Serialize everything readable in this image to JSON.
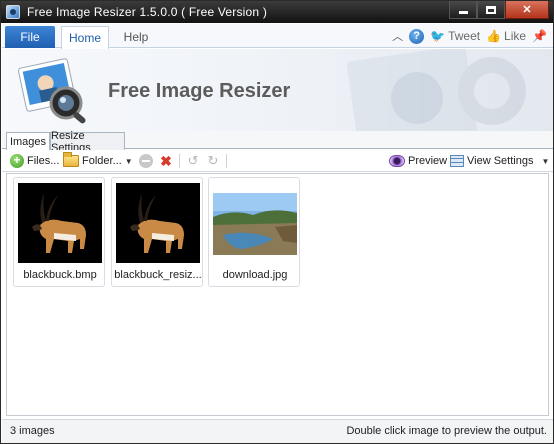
{
  "window": {
    "title": "Free Image Resizer 1.5.0.0 ( Free Version )"
  },
  "ribbon": {
    "tabs": [
      {
        "label": "File"
      },
      {
        "label": "Home"
      },
      {
        "label": "Help"
      }
    ],
    "actions": {
      "tweet_label": "Tweet",
      "like_label": "Like",
      "help_glyph": "?"
    }
  },
  "banner": {
    "title": "Free Image Resizer"
  },
  "content_tabs": [
    {
      "label": "Images",
      "active": true
    },
    {
      "label": "Resize Settings",
      "active": false
    }
  ],
  "toolbar": {
    "files_label": "Files...",
    "folder_label": "Folder...",
    "preview_label": "Preview",
    "view_settings_label": "View Settings"
  },
  "images": [
    {
      "name": "blackbuck.bmp",
      "icon": "antelope-thumbnail"
    },
    {
      "name": "blackbuck_resiz...",
      "icon": "antelope-thumbnail"
    },
    {
      "name": "download.jpg",
      "icon": "landscape-thumbnail"
    }
  ],
  "status": {
    "count_text": "3 images",
    "hint_text": "Double click image to preview the output."
  },
  "colors": {
    "file_tab": "#2a6ec2",
    "title_bar": "#1a1a1a",
    "close_button": "#c4442a",
    "delete_icon": "#d63a2a",
    "add_icon": "#3d9b22"
  }
}
